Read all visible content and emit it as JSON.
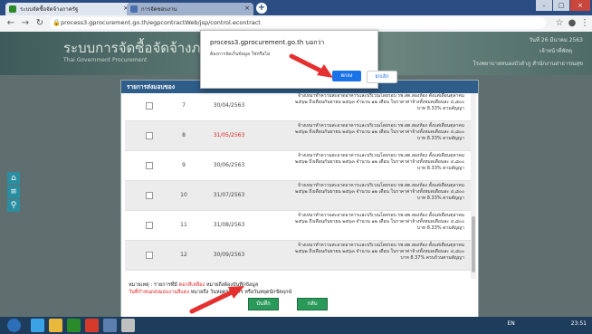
{
  "browser": {
    "tabs": [
      {
        "label": "ระบบจัดซื้อจัดจ้างภาครัฐ",
        "active": true
      },
      {
        "label": "การจัดซอบงาน",
        "active": false
      }
    ],
    "url": "process3.gprocurement.go.th/egpcontractWeb/jsp/control.econtract"
  },
  "header": {
    "title": "ระบบการจัดซื้อจัดจ้างภาครัฐ",
    "subtitle": "Thai Government Procurement",
    "right_line1": "วันที่ 26 มีนาคม 2563",
    "right_line2": "เจ้าหน้าที่พัสดุ",
    "right_line3": "โรงพยาบาลหนองบัวลำภู สำนักงานสาธารณสุข"
  },
  "dialog": {
    "title": "รายการส่งมอบของ",
    "rows": [
      {
        "no": "7",
        "date": "30/04/2563",
        "date_red": false,
        "desc": "จ้างเหมาทำความสะอาดอาคารและบริเวณโดยรอบ รพ.สต.สองห้อง ตั้งแต่เดือนตุลาคม ๒๕๖๒ ถึงเดือนกันยายน ๒๕๖๓ จำนวน ๑๒ เดือน ในราคาค่าจ้างทั้งหมดเดือนละ ๔,๘๐๐ บาท 8.33% ตามสัญญา"
      },
      {
        "no": "8",
        "date": "31/05/2563",
        "date_red": true,
        "desc": "จ้างเหมาทำความสะอาดอาคารและบริเวณโดยรอบ รพ.สต.สองห้อง ตั้งแต่เดือนตุลาคม ๒๕๖๒ ถึงเดือนกันยายน ๒๕๖๓ จำนวน ๑๒ เดือน ในราคาค่าจ้างทั้งหมดเดือนละ ๔,๘๐๐ บาท 8.33% ตามสัญญา"
      },
      {
        "no": "9",
        "date": "30/06/2563",
        "date_red": false,
        "desc": "จ้างเหมาทำความสะอาดอาคารและบริเวณโดยรอบ รพ.สต.สองห้อง ตั้งแต่เดือนตุลาคม ๒๕๖๒ ถึงเดือนกันยายน ๒๕๖๓ จำนวน ๑๒ เดือน ในราคาค่าจ้างทั้งหมดเดือนละ ๔,๘๐๐ บาท 8.33% ตามสัญญา"
      },
      {
        "no": "10",
        "date": "31/07/2563",
        "date_red": false,
        "desc": "จ้างเหมาทำความสะอาดอาคารและบริเวณโดยรอบ รพ.สต.สองห้อง ตั้งแต่เดือนตุลาคม ๒๕๖๒ ถึงเดือนกันยายน ๒๕๖๓ จำนวน ๑๒ เดือน ในราคาค่าจ้างทั้งหมดเดือนละ ๔,๘๐๐ บาท 8.33% ตามสัญญา"
      },
      {
        "no": "11",
        "date": "31/08/2563",
        "date_red": false,
        "desc": "จ้างเหมาทำความสะอาดอาคารและบริเวณโดยรอบ รพ.สต.สองห้อง ตั้งแต่เดือนตุลาคม ๒๕๖๒ ถึงเดือนกันยายน ๒๕๖๓ จำนวน ๑๒ เดือน ในราคาค่าจ้างทั้งหมดเดือนละ ๔,๘๐๐ บาท 8.33% ตามสัญญา"
      },
      {
        "no": "12",
        "date": "30/09/2563",
        "date_red": false,
        "desc": "จ้างเหมาทำความสะอาดอาคารและบริเวณโดยรอบ รพ.สต.สองห้อง ตั้งแต่เดือนตุลาคม ๒๕๖๒ ถึงเดือนกันยายน ๒๕๖๓ จำนวน ๑๒ เดือน ในราคาค่าจ้างทั้งหมดเดือนละ ๔,๘๐๐ บาท 8.37% ครบถ้วนตามสัญญา"
      }
    ],
    "note1_prefix": "หมายเหตุ : รายการที่มี",
    "note1_red": "ตอกสีเหลือง",
    "note1_suffix": "หมายถึงต้องบันทึกข้อมูล",
    "note2_red": "วันที่กำหนดส่งมอบงานสีแดง",
    "note2_suffix": "หมายถึง วันหยุดราชการ หรือวันหยุดนักขัตฤกษ์",
    "save_label": "บันทึก",
    "back_label": "กลับ"
  },
  "alert": {
    "origin": "process3.gprocurement.go.th บอกว่า",
    "message": "ต้องการจัดเก็บข้อมูล ใช่หรือไม่",
    "ok_label": "ตกลง",
    "cancel_label": "ยกเลิก"
  },
  "taskbar": {
    "lang": "EN",
    "time": "23:51"
  },
  "colors": {
    "accent": "#1a73e8",
    "red": "#dd2222",
    "arrow": "#e53030",
    "button_green": "#2a9a5a"
  }
}
